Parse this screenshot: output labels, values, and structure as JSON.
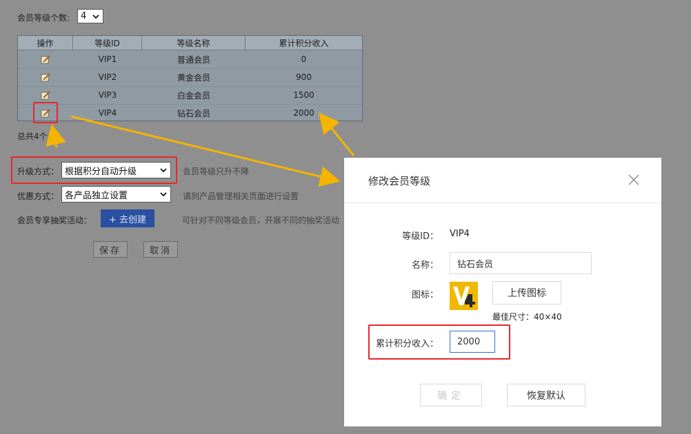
{
  "top": {
    "level_count_label": "会员等级个数:",
    "level_count_value": "4"
  },
  "table": {
    "headers": [
      "操作",
      "等级ID",
      "等级名称",
      "累计积分收入"
    ],
    "rows": [
      {
        "id": "VIP1",
        "name": "普通会员",
        "points": "0"
      },
      {
        "id": "VIP2",
        "name": "黄金会员",
        "points": "900"
      },
      {
        "id": "VIP3",
        "name": "白金会员",
        "points": "1500"
      },
      {
        "id": "VIP4",
        "name": "钻石会员",
        "points": "2000"
      }
    ]
  },
  "total": "总共4个",
  "form": {
    "upgrade_label": "升级方式：",
    "upgrade_value": "根据积分自动升级",
    "upgrade_hint": "会员等级只升不降",
    "discount_label": "优惠方式：",
    "discount_value": "各产品独立设置",
    "discount_hint": "请到产品管理相关页面进行设置",
    "lottery_label": "会员专享抽奖活动：",
    "lottery_button": "+ 去创建",
    "lottery_hint": "可针对不同等级会员，开展不同的抽奖活动",
    "save": "保存",
    "cancel": "取消"
  },
  "modal": {
    "title": "修改会员等级",
    "id_label": "等级ID：",
    "id_value": "VIP4",
    "name_label": "名称：",
    "name_value": "钻石会员",
    "icon_label": "图标：",
    "upload_button": "上传图标",
    "size_hint": "最佳尺寸：40×40",
    "points_label": "累计积分收入：",
    "points_value": "2000",
    "confirm": "确定",
    "reset": "恢复默认"
  },
  "colors": {
    "accent_red": "#e8262b",
    "arrow_yellow": "#f5b400",
    "primary_blue": "#2b4fa1",
    "icon_yellow": "#f0b800"
  }
}
